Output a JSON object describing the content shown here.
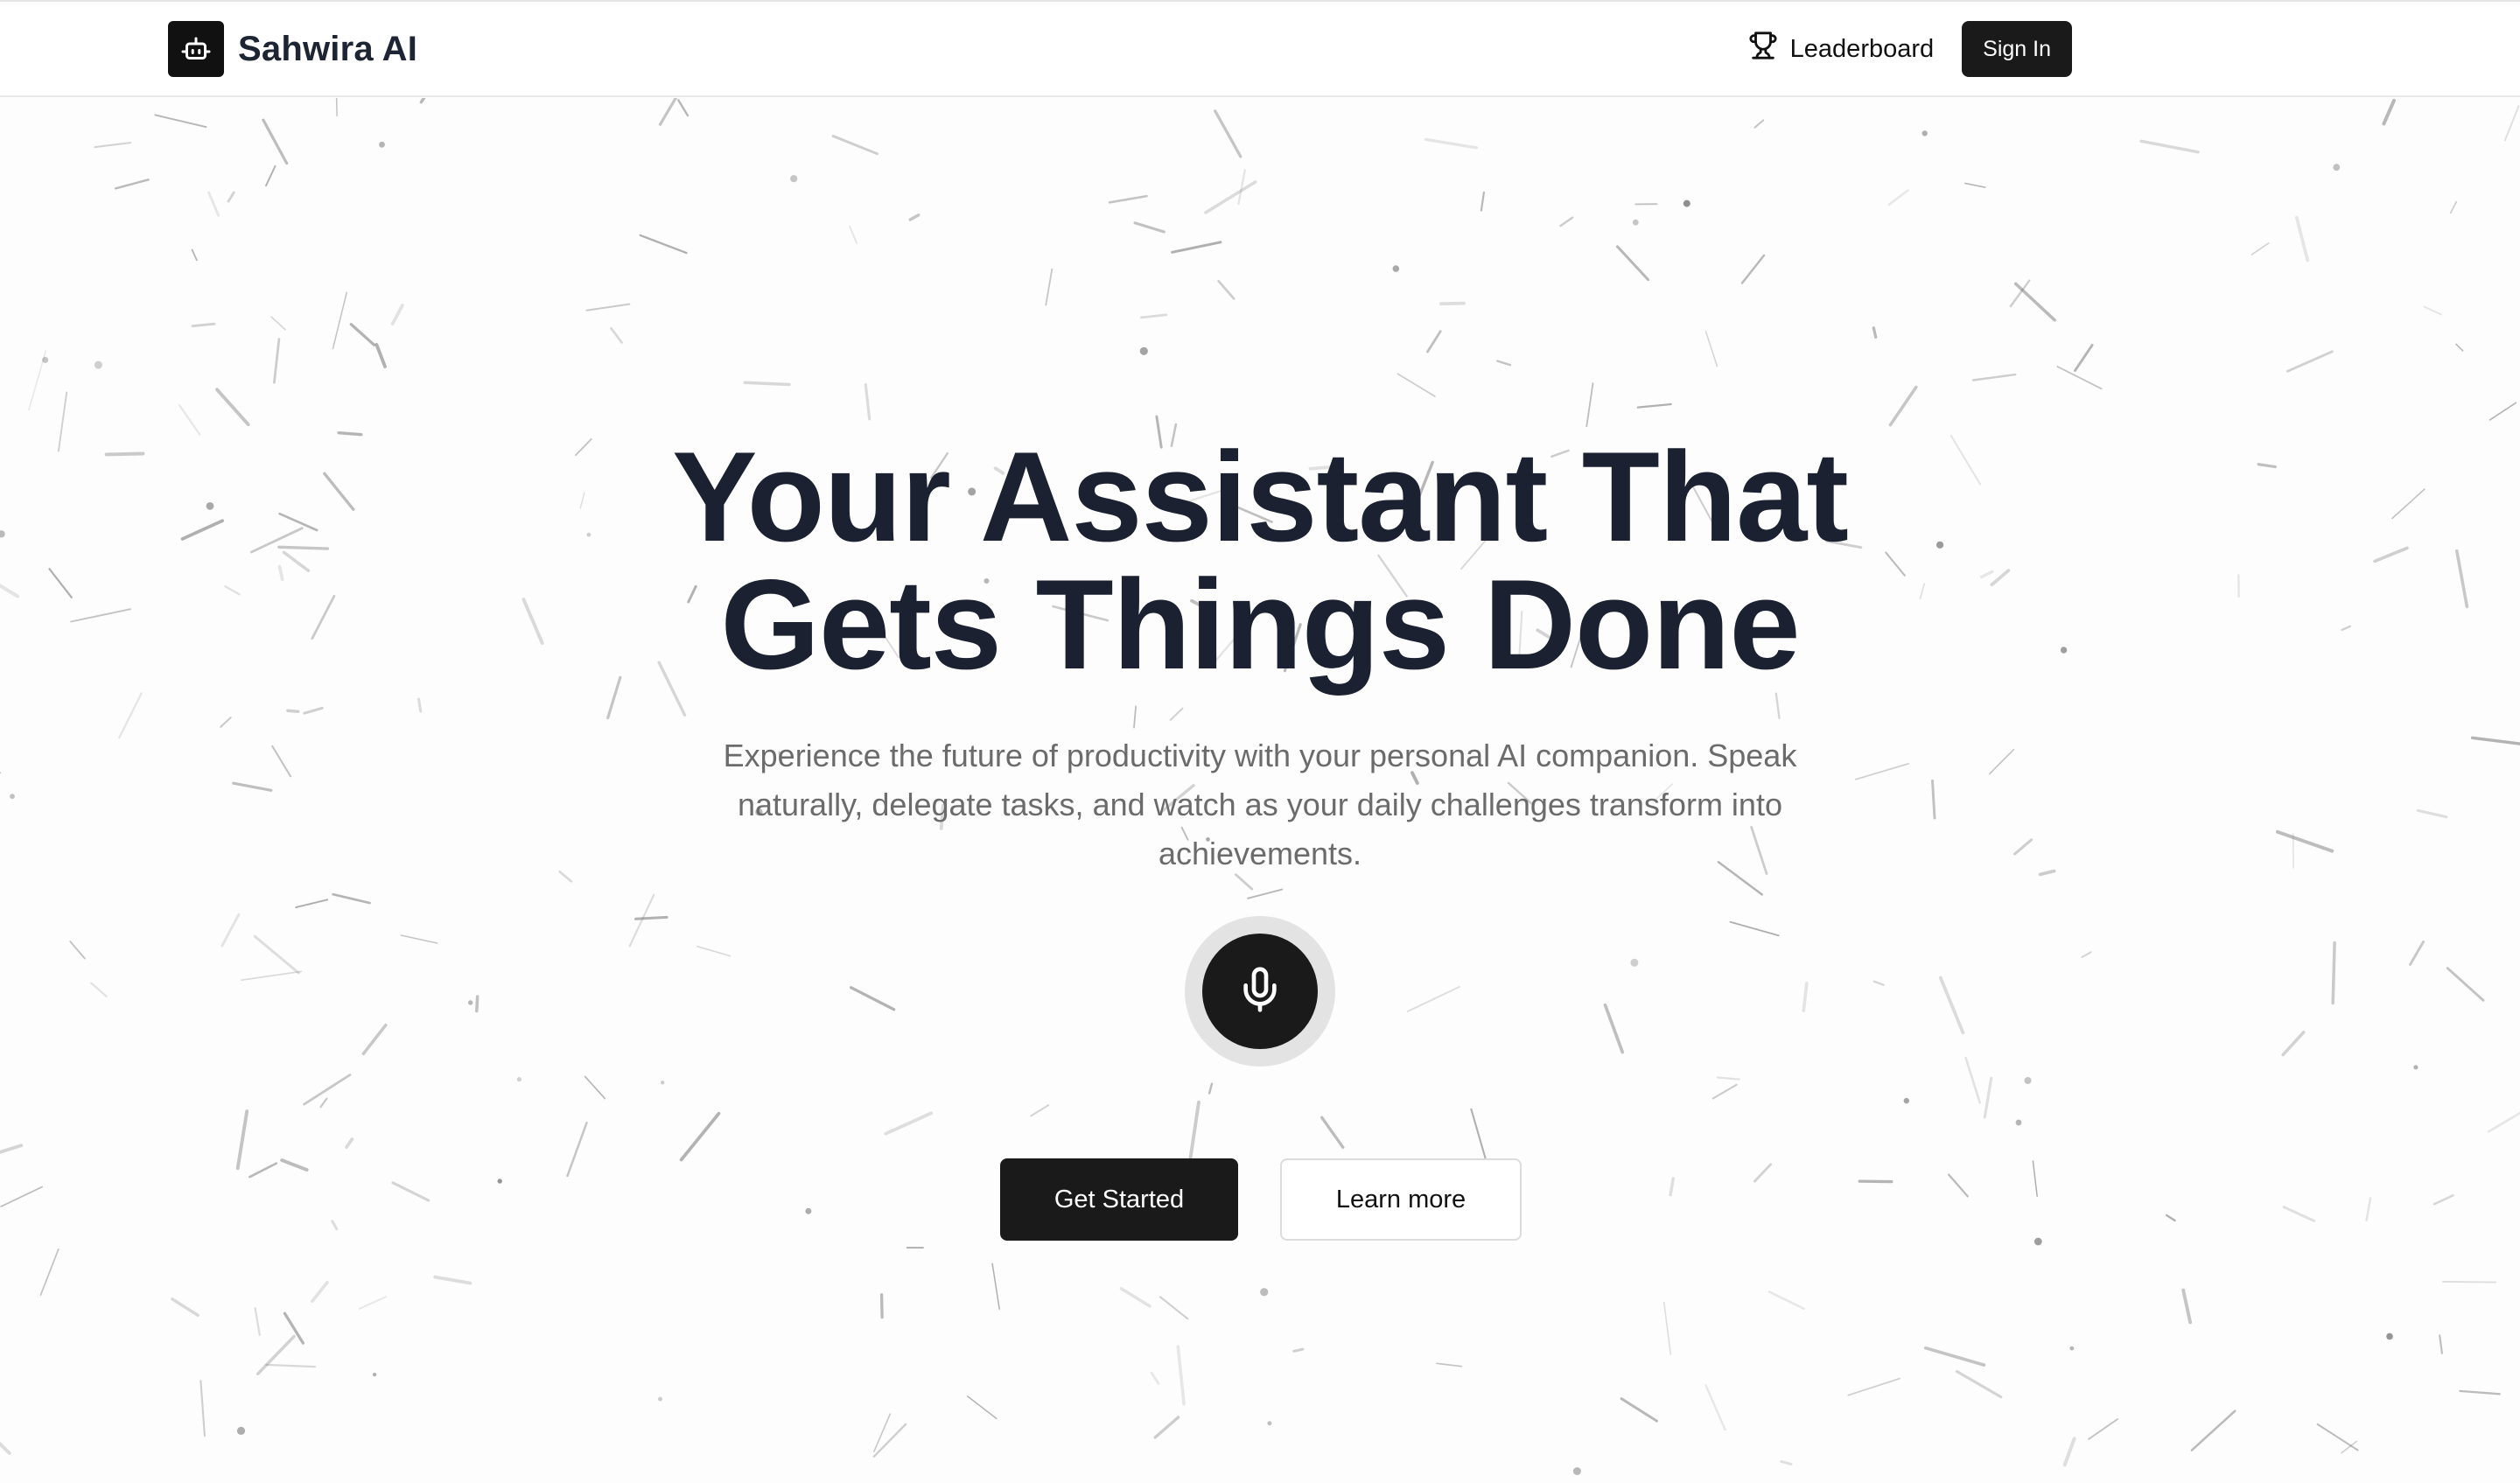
{
  "header": {
    "brand_name": "Sahwira AI",
    "brand_icon": "robot-icon",
    "leaderboard_label": "Leaderboard",
    "leaderboard_icon": "trophy-icon",
    "signin_label": "Sign In"
  },
  "hero": {
    "title_line1": "Your Assistant That",
    "title_line2": "Gets Things Done",
    "subtitle": "Experience the future of productivity with your personal AI companion. Speak naturally, delegate tasks, and watch as your daily challenges transform into achievements.",
    "mic_icon": "microphone-icon",
    "primary_cta": "Get Started",
    "secondary_cta": "Learn more"
  },
  "theme": {
    "dark": "#1a1a1a",
    "title_color": "#1b2130",
    "subtitle_color": "#6b6b6b",
    "background": "#fdfdfd"
  }
}
